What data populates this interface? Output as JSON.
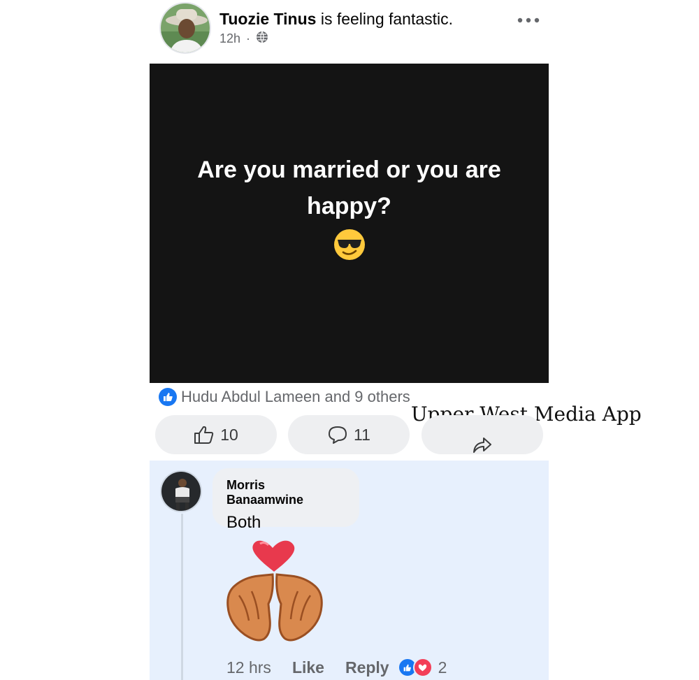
{
  "post": {
    "author": "Tuozie Tinus",
    "feeling": "is feeling fantastic.",
    "time": "12h",
    "separator": "·",
    "audience_icon": "globe-icon",
    "more_icon": "more-dots-icon",
    "text": "Are you married or you are happy?",
    "emoji": "smiling-face-with-sunglasses",
    "background_color": "#141414"
  },
  "reactions": {
    "summary": "Hudu Abdul Lameen and 9 others",
    "icon": "like-icon"
  },
  "watermark": "Upper West Media App",
  "actions": {
    "like_count": "10",
    "comment_count": "11",
    "like_icon": "thumbs-up-icon",
    "comment_icon": "comment-icon",
    "share_icon": "share-icon"
  },
  "comment": {
    "name": "Morris Banaamwine",
    "text": "Both",
    "sticker": "heart-hands-sticker",
    "time": "12 hrs",
    "like_label": "Like",
    "reply_label": "Reply",
    "reaction_count": "2"
  },
  "colors": {
    "accent": "#1877f2",
    "love": "#f33e58",
    "comment_bg": "#e7f0fd"
  }
}
